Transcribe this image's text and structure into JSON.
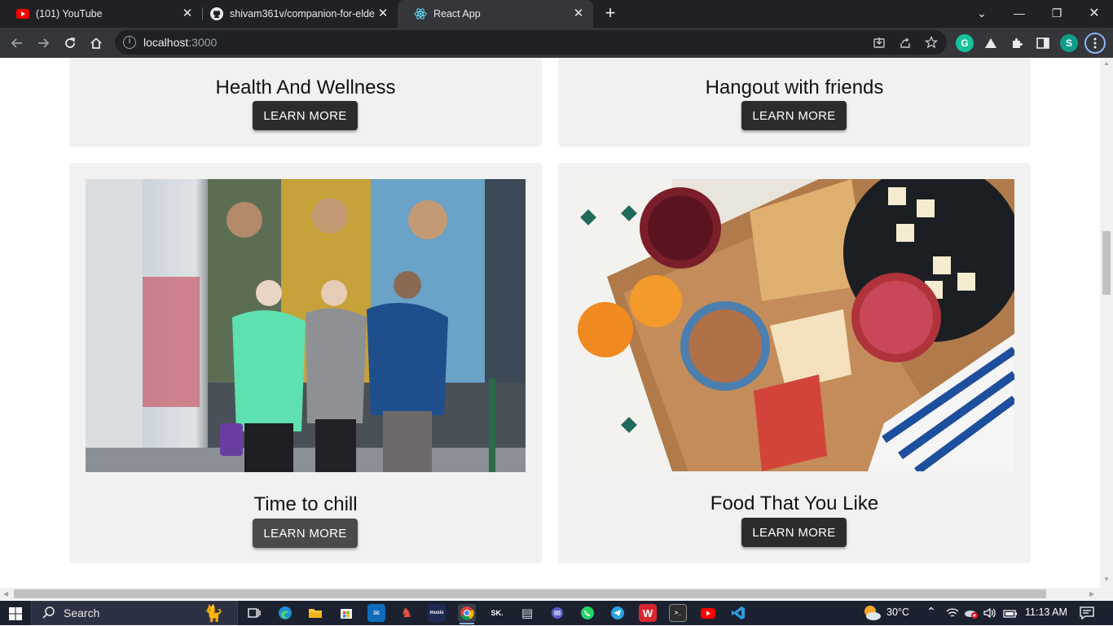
{
  "browser": {
    "tabs": [
      {
        "title": "(101) YouTube",
        "icon": "youtube-icon",
        "active": false
      },
      {
        "title": "shivam361v/companion-for-elde",
        "icon": "github-icon",
        "active": false
      },
      {
        "title": "React App",
        "icon": "react-icon",
        "active": true
      }
    ],
    "address": {
      "host": "localhost",
      "port": ":3000"
    },
    "profile_initial": "S",
    "extension_initial": "G"
  },
  "cards": [
    {
      "title": "Health And Wellness",
      "button": "LEARN MORE"
    },
    {
      "title": "Hangout with friends",
      "button": "LEARN MORE"
    },
    {
      "title": "Time to chill",
      "button": "LEARN MORE",
      "image": "elderly-friends-walking-photo"
    },
    {
      "title": "Food That You Like",
      "button": "LEARN MORE",
      "image": "food-platter-photo"
    }
  ],
  "taskbar": {
    "search_label": "Search",
    "weather": "30°C",
    "time": "11:13 AM",
    "pinned_icons": [
      "task-view-icon",
      "edge-icon",
      "file-explorer-icon",
      "store-icon",
      "mail-icon",
      "app-icon",
      "amazon-music-icon",
      "chrome-icon",
      "sk-app-icon",
      "notepad-icon",
      "app-icon",
      "whatsapp-icon",
      "telegram-icon",
      "wps-icon",
      "terminal-icon",
      "youtube-icon",
      "vscode-icon"
    ]
  },
  "colors": {
    "card_bg": "#f1f1f1",
    "button_bg": "#2c2c2c",
    "chrome_dark": "#202124",
    "chrome_toolbar": "#35363a"
  }
}
